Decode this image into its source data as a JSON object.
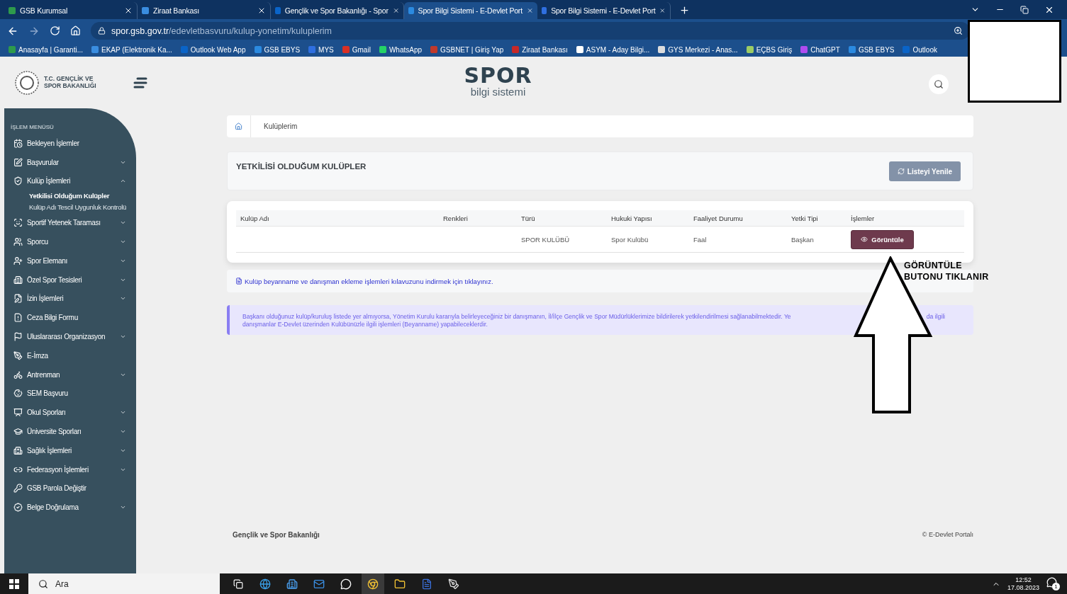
{
  "browser": {
    "tabs": [
      {
        "title": "GSB Kurumsal",
        "selected": false
      },
      {
        "title": "Ziraat Bankası",
        "selected": false
      },
      {
        "title": "Gençlik ve Spor Bakanlığı - Spor",
        "selected": false
      },
      {
        "title": "Spor Bilgi Sistemi - E-Devlet Port",
        "selected": true
      },
      {
        "title": "Spor Bilgi Sistemi - E-Devlet Port",
        "selected": false
      }
    ],
    "address": {
      "domain": "spor.gsb.gov.tr",
      "path": "/edevletbasvuru/kulup-yonetim/kuluplerim"
    },
    "bookmarks": [
      "Anasayfa | Garanti...",
      "EKAP (Elektronik Ka...",
      "Outlook Web App",
      "GSB EBYS",
      "MYS",
      "Gmail",
      "WhatsApp",
      "GSBNET | Giriş Yap",
      "Ziraat Bankası",
      "ASYM - Aday Bilgi...",
      "GYS Merkezi - Anas...",
      "EÇBS Giriş",
      "ChatGPT",
      "GSB EBYS",
      "Outlook"
    ]
  },
  "header": {
    "org_name": [
      "T.C. GENÇLİK VE",
      "SPOR BAKANLIĞI"
    ],
    "brand": "SPOR",
    "brand_sub": "bilgi sistemi"
  },
  "sidebar": {
    "heading": "İŞLEM MENÜSÜ",
    "items": [
      {
        "label": "Bekleyen İşlemler",
        "kind": "link"
      },
      {
        "label": "Başvurular",
        "kind": "group",
        "expanded": false
      },
      {
        "label": "Kulüp İşlemleri",
        "kind": "group",
        "expanded": true,
        "children": [
          {
            "label": "Yetkilisi Olduğum Kulüpler",
            "selected": true
          },
          {
            "label": "Kulüp Adı Tescil Uygunluk Kontrolü",
            "selected": false
          }
        ]
      },
      {
        "label": "Sportif Yetenek Taraması",
        "kind": "group",
        "expanded": false
      },
      {
        "label": "Sporcu",
        "kind": "group",
        "expanded": false
      },
      {
        "label": "Spor Elemanı",
        "kind": "group",
        "expanded": false
      },
      {
        "label": "Özel Spor Tesisleri",
        "kind": "group",
        "expanded": false
      },
      {
        "label": "İzin İşlemleri",
        "kind": "group",
        "expanded": false
      },
      {
        "label": "Ceza Bilgi Formu",
        "kind": "link"
      },
      {
        "label": "Uluslararası Organizasyon",
        "kind": "group",
        "expanded": false
      },
      {
        "label": "E-İmza",
        "kind": "link"
      },
      {
        "label": "Antrenman",
        "kind": "group",
        "expanded": false
      },
      {
        "label": "SEM Başvuru",
        "kind": "link"
      },
      {
        "label": "Okul Sporları",
        "kind": "group",
        "expanded": false
      },
      {
        "label": "Üniversite Sporları",
        "kind": "group",
        "expanded": false
      },
      {
        "label": "Sağlık İşlemleri",
        "kind": "group",
        "expanded": false
      },
      {
        "label": "Federasyon İşlemleri",
        "kind": "group",
        "expanded": false
      },
      {
        "label": "GSB Parola Değiştir",
        "kind": "link"
      },
      {
        "label": "Belge Doğrulama",
        "kind": "group",
        "expanded": false
      }
    ]
  },
  "breadcrumb": "Kulüplerim",
  "card": {
    "title": "YETKİLİSİ OLDUĞUM KULÜPLER",
    "refresh_button": "Listeyi Yenile"
  },
  "table": {
    "columns": [
      "Kulüp Adı",
      "Renkleri",
      "Türü",
      "Hukuki Yapısı",
      "Faaliyet Durumu",
      "Yetki Tipi",
      "İşlemler"
    ],
    "rows": [
      {
        "type": "SPOR KULÜBÜ",
        "legal_structure": "Spor Kulübü",
        "activity_status": "Faal",
        "authority_type": "Başkan",
        "action": "Görüntüle"
      }
    ]
  },
  "download_link": "Kulüp beyanname ve danışman ekleme işlemleri kılavuzunu indirmek için tıklayınız.",
  "notice": {
    "line_1_start": "Başkanı olduğunuz kulüp/kuruluş listede yer almıyorsa, Yönetim Kurulu kararıyla belirleyeceğiniz bir danışmanın, İl/İlçe Gençlik ve Spor Müdürlüklerimize bildirilerek yetkilendirilmesi sağlanabilmektedir. Ye",
    "line_1_end": "da ilgili",
    "line_2": "danışmanlar E-Devlet üzerinden Kulübünüzle ilgili işlemleri (Beyanname) yapabileceklerdir."
  },
  "annotation": [
    "GÖRÜNTÜLE",
    "BUTONU TIKLANIR"
  ],
  "footer": {
    "left": "Gençlik ve Spor Bakanlığı",
    "right": "© E-Devlet Portalı"
  },
  "taskbar": {
    "search_placeholder": "Ara",
    "time": "12:52",
    "date": "17.08.2023",
    "notifications": "1"
  }
}
